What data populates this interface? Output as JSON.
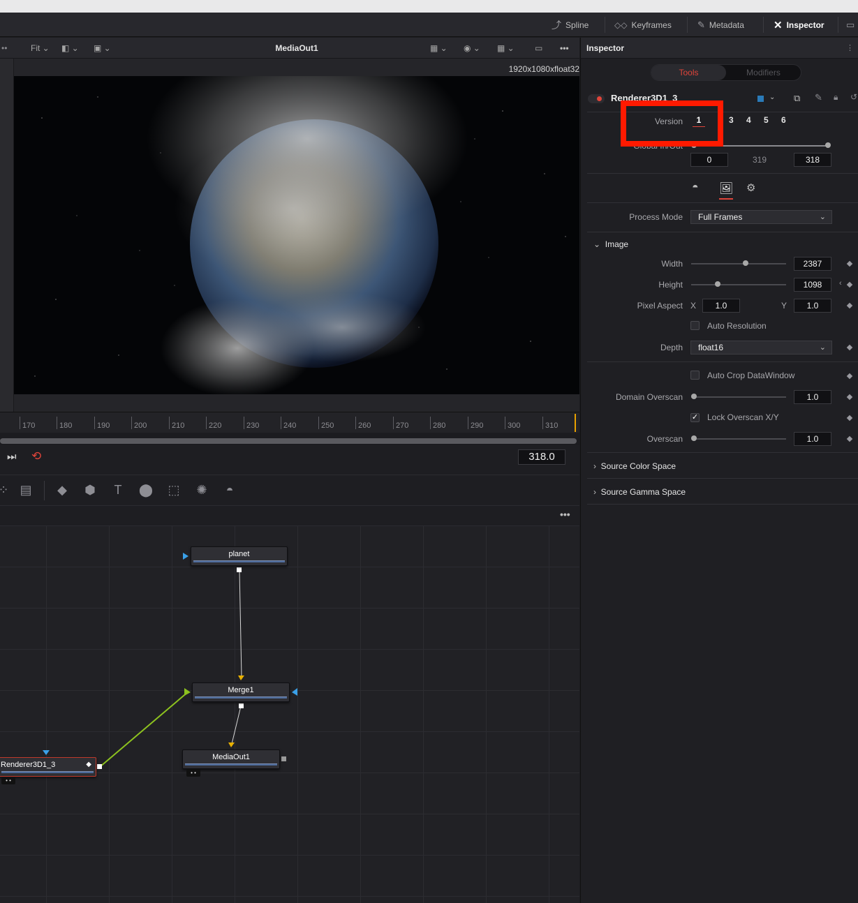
{
  "toolbar": {
    "spline": "Spline",
    "keyframes": "Keyframes",
    "metadata": "Metadata",
    "inspector": "Inspector"
  },
  "viewer": {
    "zoom": "Fit",
    "title": "MediaOut1",
    "resolution": "1920x1080xfloat32",
    "ruler_ticks": [
      "170",
      "180",
      "190",
      "200",
      "210",
      "220",
      "230",
      "240",
      "250",
      "260",
      "270",
      "280",
      "290",
      "300",
      "310"
    ],
    "current_frame": "318.0"
  },
  "nodes": {
    "planet": "planet",
    "merge": "Merge1",
    "mediaout": "MediaOut1",
    "renderer": "Renderer3D1_3"
  },
  "inspector": {
    "title": "Inspector",
    "tabs": {
      "tools": "Tools",
      "modifiers": "Modifiers"
    },
    "tool_name": "Renderer3D1_3",
    "version_label": "Version",
    "versions": [
      "1",
      "3",
      "4",
      "5",
      "6"
    ],
    "global_inout_label": "Global In/Out",
    "global_in": "0",
    "global_mid": "319",
    "global_out": "318",
    "process_mode_label": "Process Mode",
    "process_mode": "Full Frames",
    "image_section": "Image",
    "width_label": "Width",
    "width": "2387",
    "height_label": "Height",
    "height": "1098",
    "pixel_aspect_label": "Pixel Aspect",
    "x_label": "X",
    "y_label": "Y",
    "pixel_aspect_x": "1.0",
    "pixel_aspect_y": "1.0",
    "auto_resolution": "Auto Resolution",
    "depth_label": "Depth",
    "depth": "float16",
    "auto_crop": "Auto Crop DataWindow",
    "domain_overscan_label": "Domain Overscan",
    "domain_overscan": "1.0",
    "lock_overscan": "Lock Overscan X/Y",
    "lock_overscan_checked": true,
    "overscan_label": "Overscan",
    "overscan": "1.0",
    "source_color_space": "Source Color Space",
    "source_gamma_space": "Source Gamma Space",
    "accent_color": "#e0443a",
    "highlight_color": "#ff1a00"
  }
}
